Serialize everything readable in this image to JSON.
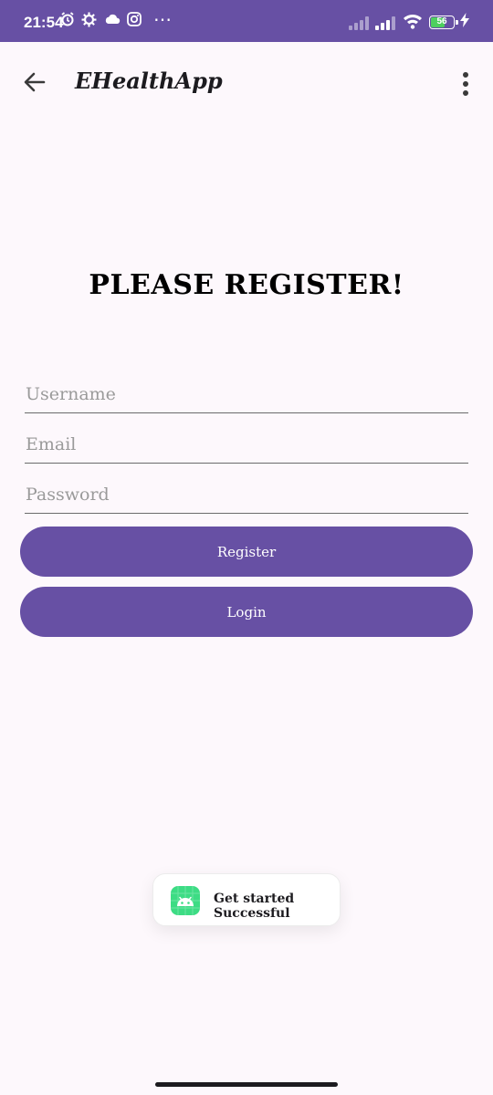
{
  "status_bar": {
    "time": "21:54",
    "battery_level": "56",
    "icons": [
      "alarm-icon",
      "settings-gear-icon",
      "cloud-icon",
      "instagram-icon",
      "more-dots-icon",
      "signal-icon",
      "wifi-icon",
      "battery-icon",
      "charging-bolt-icon"
    ]
  },
  "app_bar": {
    "title": "EHealthApp",
    "back_icon": "arrow-back-icon",
    "menu_icon": "more-vert-icon"
  },
  "form": {
    "heading": "PLEASE REGISTER!",
    "username_placeholder": "Username",
    "username_value": "",
    "email_placeholder": "Email",
    "email_value": "",
    "password_placeholder": "Password",
    "password_value": "",
    "register_label": "Register",
    "login_label": "Login"
  },
  "toast": {
    "message": "Get started Successful",
    "icon": "android-app-icon"
  },
  "colors": {
    "primary": "#6750a4",
    "background": "#fdf8fc",
    "toast_icon": "#3ddc84"
  }
}
